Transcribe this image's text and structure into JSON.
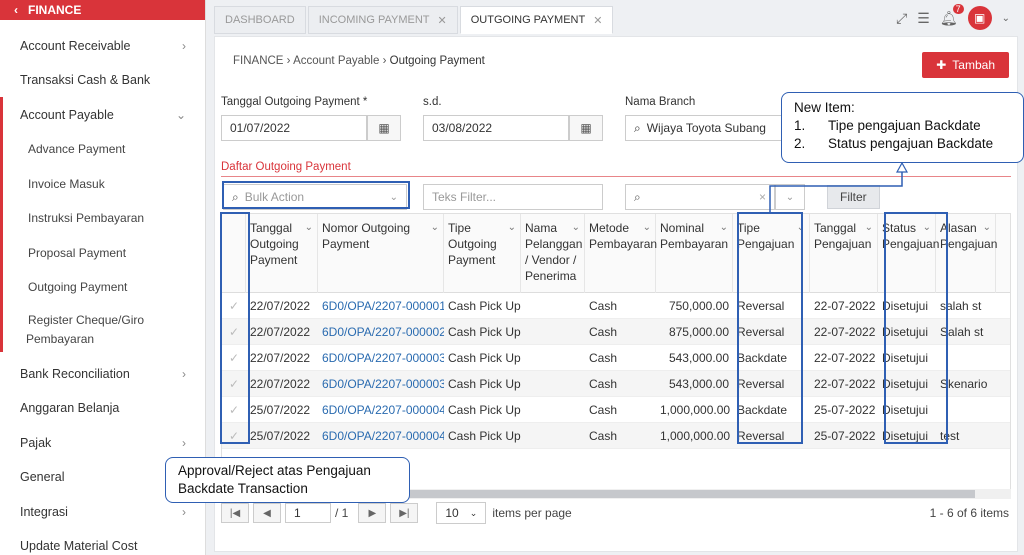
{
  "sidebar": {
    "header": "FINANCE",
    "items": [
      {
        "label": "Account Receivable",
        "chev": "›"
      },
      {
        "label": "Transaksi Cash & Bank",
        "chev": ""
      },
      {
        "label": "Account Payable",
        "chev": "⌄"
      },
      {
        "label": "Advance Payment",
        "chev": ""
      },
      {
        "label": "Invoice Masuk",
        "chev": ""
      },
      {
        "label": "Instruksi Pembayaran",
        "chev": ""
      },
      {
        "label": "Proposal Payment",
        "chev": ""
      },
      {
        "label": "Outgoing Payment",
        "chev": ""
      },
      {
        "label": "Register Cheque/Giro",
        "chev": ""
      },
      {
        "label": "Pembayaran",
        "chev": ""
      },
      {
        "label": "Bank Reconciliation",
        "chev": "›"
      },
      {
        "label": "Anggaran Belanja",
        "chev": ""
      },
      {
        "label": "Pajak",
        "chev": "›"
      },
      {
        "label": "General",
        "chev": ""
      },
      {
        "label": "Integrasi",
        "chev": "›"
      },
      {
        "label": "Update Material Cost",
        "chev": ""
      }
    ]
  },
  "tabs": [
    {
      "label": "DASHBOARD"
    },
    {
      "label": "INCOMING PAYMENT"
    },
    {
      "label": "OUTGOING PAYMENT"
    }
  ],
  "topbar": {
    "notif_count": "7"
  },
  "breadcrumb": {
    "root": "FINANCE",
    "parent": "Account Payable",
    "current": "Outgoing Payment"
  },
  "add_button": "Tambah",
  "form": {
    "date_label": "Tanggal Outgoing Payment *",
    "date_from": "01/07/2022",
    "sd_label": "s.d.",
    "date_to": "03/08/2022",
    "branch_label": "Nama Branch",
    "branch_value": "Wijaya Toyota Subang"
  },
  "section_title": "Daftar Outgoing Payment",
  "filters": {
    "bulk_placeholder": "Bulk Action",
    "text_placeholder": "Teks Filter...",
    "filter_button": "Filter"
  },
  "table": {
    "headers": [
      [
        "Tanggal",
        "Outgoing",
        "Payment"
      ],
      [
        "Nomor Outgoing",
        "Payment"
      ],
      [
        "Tipe",
        "Outgoing",
        "Payment"
      ],
      [
        "Nama",
        "Pelanggan",
        "/ Vendor /",
        "Penerima"
      ],
      [
        "Metode",
        "Pembayaran"
      ],
      [
        "Nominal",
        "Pembayaran"
      ],
      [
        "Tipe",
        "Pengajuan"
      ],
      [
        "Tanggal",
        "Pengajuan"
      ],
      [
        "Status",
        "Pengajuan"
      ],
      [
        "Alasan",
        "Pengajuan"
      ]
    ],
    "rows": [
      [
        "22/07/2022",
        "6D0/OPA/2207-000001",
        "Cash Pick Up",
        "",
        "Cash",
        "750,000.00",
        "Reversal",
        "22-07-2022",
        "Disetujui",
        "salah st"
      ],
      [
        "22/07/2022",
        "6D0/OPA/2207-000002",
        "Cash Pick Up",
        "",
        "Cash",
        "875,000.00",
        "Reversal",
        "22-07-2022",
        "Disetujui",
        "Salah st"
      ],
      [
        "22/07/2022",
        "6D0/OPA/2207-000003",
        "Cash Pick Up",
        "",
        "Cash",
        "543,000.00",
        "Backdate",
        "22-07-2022",
        "Disetujui",
        ""
      ],
      [
        "22/07/2022",
        "6D0/OPA/2207-000003",
        "Cash Pick Up",
        "",
        "Cash",
        "543,000.00",
        "Reversal",
        "22-07-2022",
        "Disetujui",
        "Skenario"
      ],
      [
        "25/07/2022",
        "6D0/OPA/2207-000004",
        "Cash Pick Up",
        "",
        "Cash",
        "1,000,000.00",
        "Backdate",
        "25-07-2022",
        "Disetujui",
        ""
      ],
      [
        "25/07/2022",
        "6D0/OPA/2207-000004",
        "Cash Pick Up",
        "",
        "Cash",
        "1,000,000.00",
        "Reversal",
        "25-07-2022",
        "Disetujui",
        "test"
      ]
    ]
  },
  "pager": {
    "page": "1",
    "of": "/ 1",
    "size": "10",
    "size_label": "items per page",
    "summary": "1 - 6 of 6 items"
  },
  "callouts": {
    "new_item_title": "New Item:",
    "new_item_1_num": "1.",
    "new_item_1": "Tipe pengajuan Backdate",
    "new_item_2_num": "2.",
    "new_item_2": "Status pengajuan Backdate",
    "approval_1": "Approval/Reject atas Pengajuan",
    "approval_2": "Backdate Transaction"
  }
}
